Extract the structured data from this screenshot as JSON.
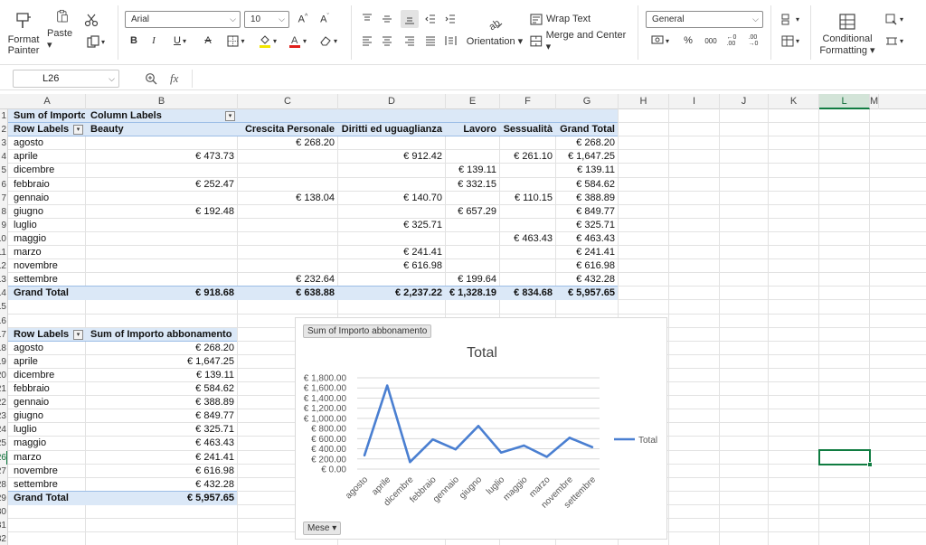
{
  "ribbon": {
    "format_painter": [
      "Format",
      "Painter"
    ],
    "paste": "Paste",
    "font_name": "Arial",
    "font_size": "10",
    "orientation": "Orientation",
    "wrap_text": "Wrap Text",
    "merge_center": "Merge and Center",
    "number_format": "General",
    "thousands": "000",
    "conditional_formatting": [
      "Conditional",
      "Formatting"
    ]
  },
  "name_box": "L26",
  "columns": [
    "A",
    "B",
    "C",
    "D",
    "E",
    "F",
    "G",
    "H",
    "I",
    "J",
    "K",
    "L",
    "M"
  ],
  "rows": [
    "1",
    "2",
    "3",
    "4",
    "5",
    "6",
    "7",
    "8",
    "9",
    "10",
    "11",
    "12",
    "13",
    "14",
    "15",
    "16",
    "17",
    "18",
    "19",
    "20",
    "21",
    "22",
    "23",
    "24",
    "25",
    "26",
    "27",
    "28",
    "29",
    "30",
    "31",
    "32"
  ],
  "pivot1": {
    "header_left": "Sum of Importo",
    "header_right": "Column Labels",
    "col_row_label": "Row Labels",
    "col_headers": [
      "Beauty",
      "Crescita Personale",
      "Diritti ed uguaglianza",
      "Lavoro",
      "Sessualità",
      "Grand Total"
    ],
    "rows": [
      {
        "label": "agosto",
        "values": [
          "",
          "€ 268.20",
          "",
          "",
          "",
          "€ 268.20"
        ]
      },
      {
        "label": "aprile",
        "values": [
          "€ 473.73",
          "",
          "€ 912.42",
          "",
          "€ 261.10",
          "€ 1,647.25"
        ]
      },
      {
        "label": "dicembre",
        "values": [
          "",
          "",
          "",
          "€ 139.11",
          "",
          "€ 139.11"
        ]
      },
      {
        "label": "febbraio",
        "values": [
          "€ 252.47",
          "",
          "",
          "€ 332.15",
          "",
          "€ 584.62"
        ]
      },
      {
        "label": "gennaio",
        "values": [
          "",
          "€ 138.04",
          "€ 140.70",
          "",
          "€ 110.15",
          "€ 388.89"
        ]
      },
      {
        "label": "giugno",
        "values": [
          "€ 192.48",
          "",
          "",
          "€ 657.29",
          "",
          "€ 849.77"
        ]
      },
      {
        "label": "luglio",
        "values": [
          "",
          "",
          "€ 325.71",
          "",
          "",
          "€ 325.71"
        ]
      },
      {
        "label": "maggio",
        "values": [
          "",
          "",
          "",
          "",
          "€ 463.43",
          "€ 463.43"
        ]
      },
      {
        "label": "marzo",
        "values": [
          "",
          "",
          "€ 241.41",
          "",
          "",
          "€ 241.41"
        ]
      },
      {
        "label": "novembre",
        "values": [
          "",
          "",
          "€ 616.98",
          "",
          "",
          "€ 616.98"
        ]
      },
      {
        "label": "settembre",
        "values": [
          "",
          "€ 232.64",
          "",
          "€ 199.64",
          "",
          "€ 432.28"
        ]
      }
    ],
    "total": {
      "label": "Grand Total",
      "values": [
        "€ 918.68",
        "€ 638.88",
        "€ 2,237.22",
        "€ 1,328.19",
        "€ 834.68",
        "€ 5,957.65"
      ]
    }
  },
  "pivot2": {
    "col_row_label": "Row Labels",
    "col_value_label": "Sum of Importo abbonamento",
    "rows": [
      {
        "label": "agosto",
        "value": "€ 268.20"
      },
      {
        "label": "aprile",
        "value": "€ 1,647.25"
      },
      {
        "label": "dicembre",
        "value": "€ 139.11"
      },
      {
        "label": "febbraio",
        "value": "€ 584.62"
      },
      {
        "label": "gennaio",
        "value": "€ 388.89"
      },
      {
        "label": "giugno",
        "value": "€ 849.77"
      },
      {
        "label": "luglio",
        "value": "€ 325.71"
      },
      {
        "label": "maggio",
        "value": "€ 463.43"
      },
      {
        "label": "marzo",
        "value": "€ 241.41"
      },
      {
        "label": "novembre",
        "value": "€ 616.98"
      },
      {
        "label": "settembre",
        "value": "€ 432.28"
      }
    ],
    "total": {
      "label": "Grand Total",
      "value": "€ 5,957.65"
    }
  },
  "chart": {
    "field_button": "Sum of Importo abbonamento",
    "axis_button": "Mese",
    "title": "Total",
    "legend": "Total",
    "line_color": "#4a7fd1"
  },
  "chart_data": {
    "type": "line",
    "title": "Total",
    "categories": [
      "agosto",
      "aprile",
      "dicembre",
      "febbraio",
      "gennaio",
      "giugno",
      "luglio",
      "maggio",
      "marzo",
      "novembre",
      "settembre"
    ],
    "series": [
      {
        "name": "Total",
        "values": [
          268.2,
          1647.25,
          139.11,
          584.62,
          388.89,
          849.77,
          325.71,
          463.43,
          241.41,
          616.98,
          432.28
        ]
      }
    ],
    "y_ticks": [
      "€ 0.00",
      "€ 200.00",
      "€ 400.00",
      "€ 600.00",
      "€ 800.00",
      "€ 1,000.00",
      "€ 1,200.00",
      "€ 1,400.00",
      "€ 1,600.00",
      "€ 1,800.00"
    ],
    "ylim": [
      0,
      1800
    ],
    "grid": true,
    "legend_position": "right"
  }
}
